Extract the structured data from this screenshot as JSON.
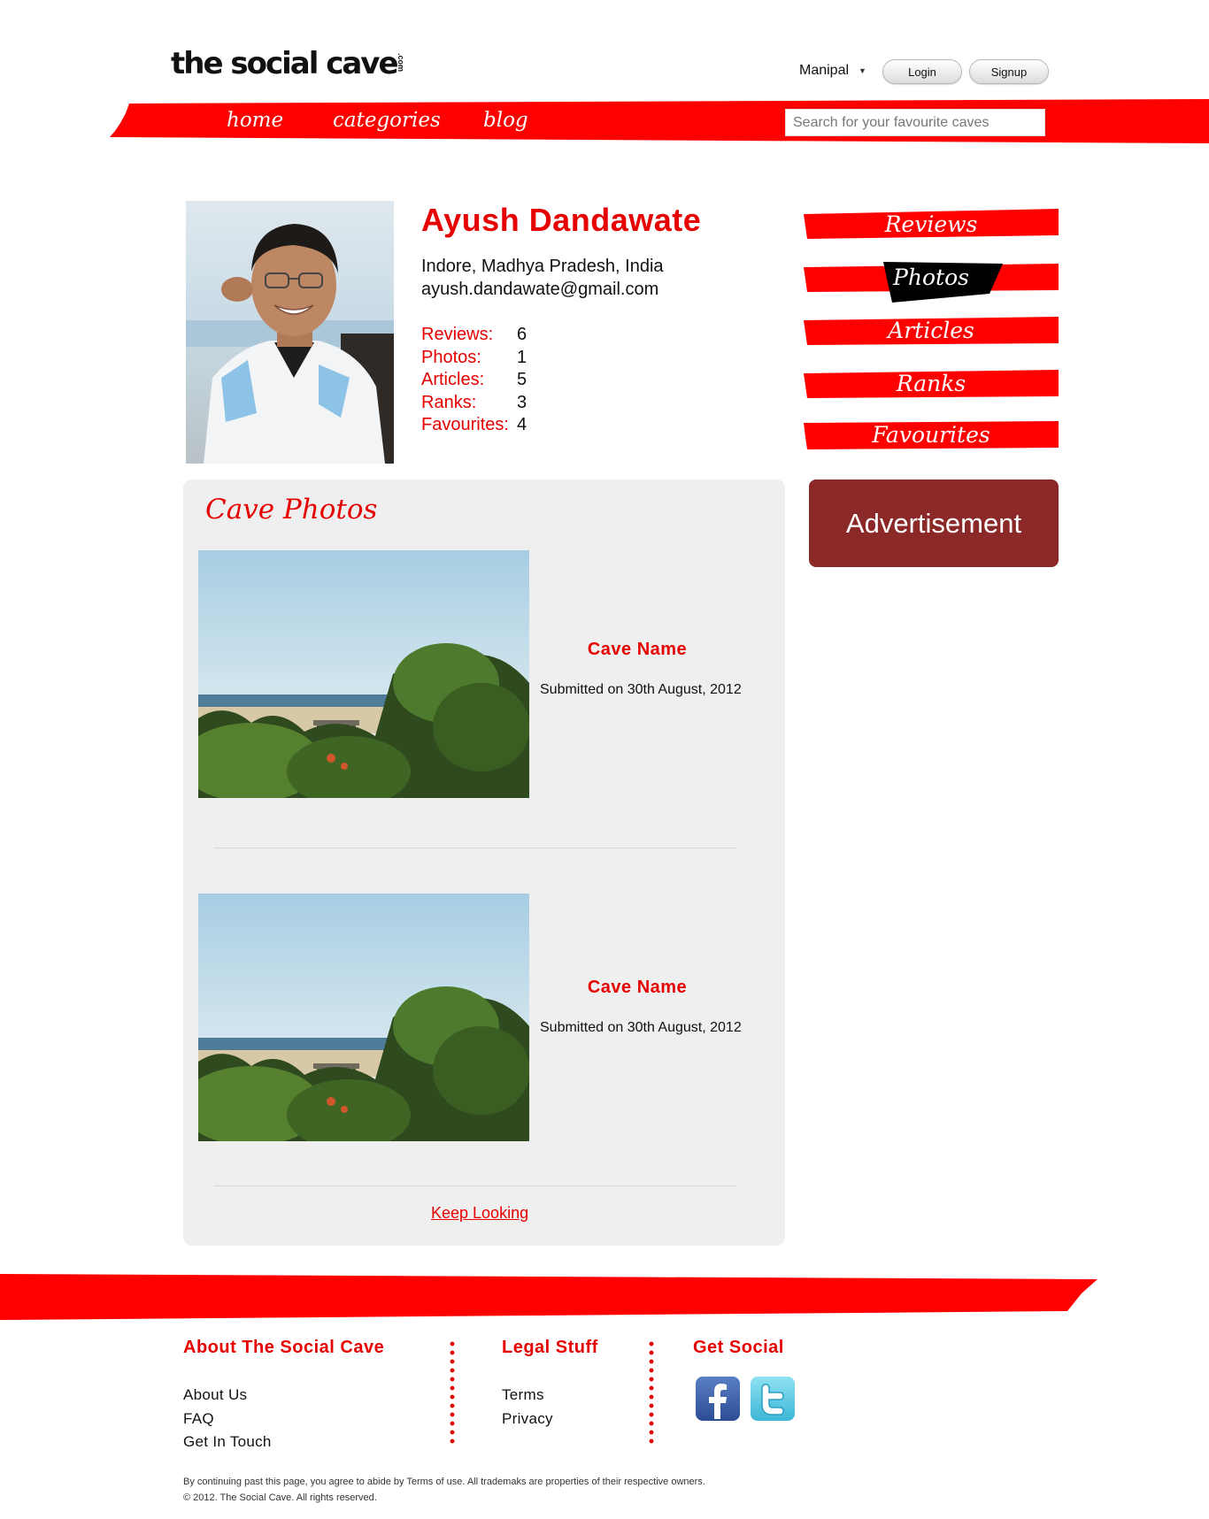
{
  "header": {
    "logo_text": "the social cave",
    "logo_suffix": ".com",
    "location": "Manipal",
    "login_label": "Login",
    "signup_label": "Signup"
  },
  "nav": {
    "items": [
      "home",
      "categories",
      "blog"
    ],
    "search_placeholder": "Search for your favourite caves"
  },
  "profile": {
    "name": "Ayush Dandawate",
    "location": "Indore, Madhya Pradesh, India",
    "email": "ayush.dandawate@gmail.com",
    "stats": [
      {
        "label": "Reviews:",
        "value": "6"
      },
      {
        "label": "Photos:",
        "value": "1"
      },
      {
        "label": "Articles:",
        "value": "5"
      },
      {
        "label": "Ranks:",
        "value": "3"
      },
      {
        "label": "Favourites:",
        "value": "4"
      }
    ]
  },
  "tabs": {
    "items": [
      "Reviews",
      "Photos",
      "Articles",
      "Ranks",
      "Favourites"
    ],
    "active": "Photos"
  },
  "advertisement": "Advertisement",
  "photos_panel": {
    "title": "Cave Photos",
    "items": [
      {
        "name": "Cave Name",
        "submitted": "Submitted on 30th August, 2012"
      },
      {
        "name": "Cave Name",
        "submitted": "Submitted on 30th August, 2012"
      }
    ],
    "more_link": "Keep Looking"
  },
  "footer": {
    "about_heading": "About The Social Cave",
    "about_links": [
      "About Us",
      "FAQ",
      "Get In Touch"
    ],
    "legal_heading": "Legal Stuff",
    "legal_links": [
      "Terms",
      "Privacy"
    ],
    "social_heading": "Get Social",
    "social_icons": [
      "facebook-icon",
      "twitter-icon"
    ],
    "disclaimer_line1": "By continuing past this page, you agree to abide by Terms of use. All trademaks are properties of their respective owners.",
    "disclaimer_line2": "© 2012. The Social Cave. All rights reserved."
  },
  "colors": {
    "brand_red": "#e60000",
    "ad_background": "#8b2828",
    "panel_background": "#efefef"
  }
}
